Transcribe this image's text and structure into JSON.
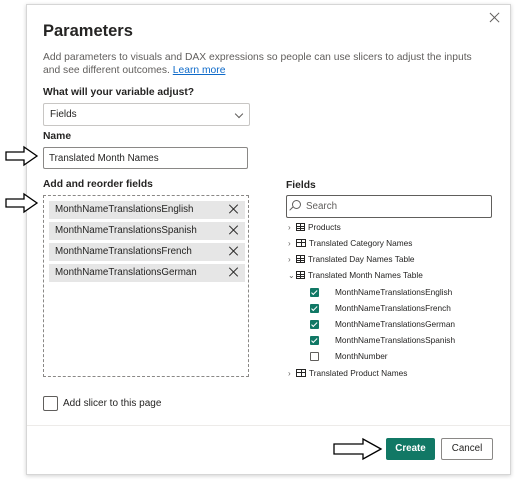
{
  "dialog": {
    "title": "Parameters",
    "description": "Add parameters to visuals and DAX expressions so people can use slicers to adjust the inputs and see different outcomes.",
    "learn_more": "Learn more"
  },
  "variable": {
    "label": "What will your variable adjust?",
    "selected": "Fields"
  },
  "name": {
    "label": "Name",
    "value": "Translated Month Names"
  },
  "add_fields": {
    "label": "Add and reorder fields",
    "items": [
      "MonthNameTranslationsEnglish",
      "MonthNameTranslationsSpanish",
      "MonthNameTranslationsFrench",
      "MonthNameTranslationsGerman"
    ]
  },
  "slicer": {
    "label": "Add slicer to this page",
    "checked": false
  },
  "fields_panel": {
    "label": "Fields",
    "search_placeholder": "Search",
    "tree": [
      {
        "label": "Products",
        "type": "table",
        "expanded": false
      },
      {
        "label": "Translated Category Names",
        "type": "calc-table",
        "expanded": false
      },
      {
        "label": "Translated Day Names Table",
        "type": "table",
        "expanded": false
      },
      {
        "label": "Translated Month Names Table",
        "type": "table",
        "expanded": true,
        "children": [
          {
            "label": "MonthNameTranslationsEnglish",
            "checked": true
          },
          {
            "label": "MonthNameTranslationsFrench",
            "checked": true
          },
          {
            "label": "MonthNameTranslationsGerman",
            "checked": true
          },
          {
            "label": "MonthNameTranslationsSpanish",
            "checked": true
          },
          {
            "label": "MonthNumber",
            "checked": false
          }
        ]
      },
      {
        "label": "Translated Product Names",
        "type": "calc-table",
        "expanded": false
      }
    ]
  },
  "footer": {
    "create_label": "Create",
    "cancel_label": "Cancel"
  },
  "colors": {
    "accent": "#117865",
    "link": "#0e6ac9"
  }
}
